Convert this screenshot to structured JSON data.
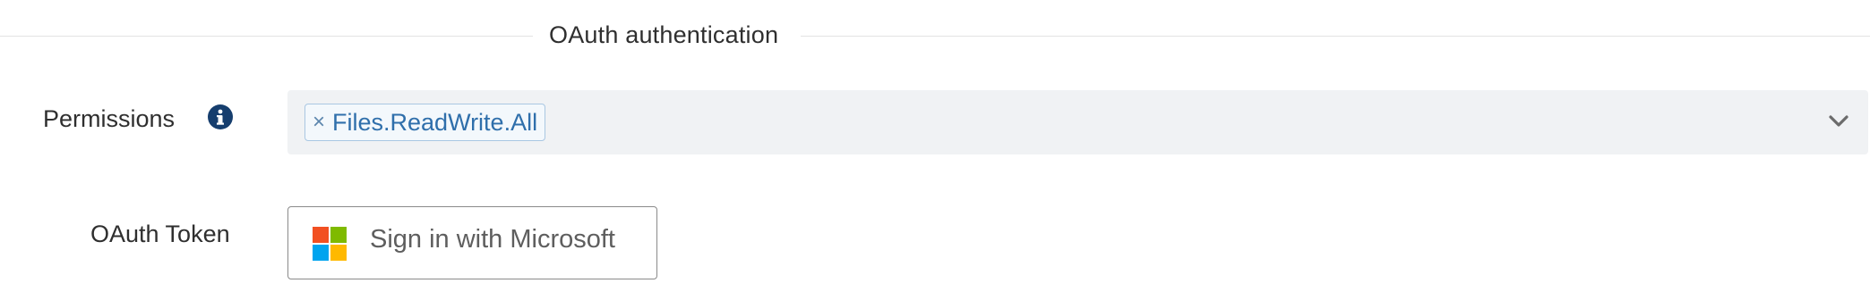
{
  "section": {
    "title": "OAuth authentication"
  },
  "permissions": {
    "label": "Permissions",
    "selected_tags": [
      "Files.ReadWrite.All"
    ],
    "remove_glyph": "×",
    "info_icon": "info-circle-icon",
    "dropdown_icon": "chevron-down-icon"
  },
  "oauth_token": {
    "label": "OAuth Token",
    "button_label": "Sign in with Microsoft",
    "logo_colors": [
      "#f25022",
      "#7fba00",
      "#00a4ef",
      "#ffb900"
    ]
  }
}
